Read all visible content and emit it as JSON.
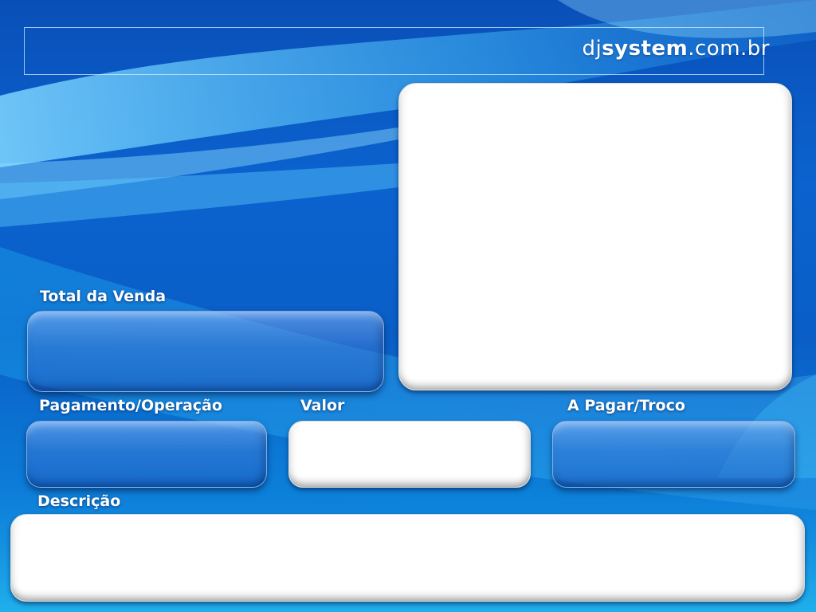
{
  "app": {
    "brand_prefix": "dj",
    "brand_strong": "system",
    "brand_suffix": ".com.br"
  },
  "display": {
    "image_panel": ""
  },
  "fields": {
    "total_venda": {
      "label": "Total da Venda",
      "value": ""
    },
    "pagamento_operacao": {
      "label": "Pagamento/Operação",
      "value": ""
    },
    "valor": {
      "label": "Valor",
      "value": ""
    },
    "a_pagar_troco": {
      "label": "A Pagar/Troco",
      "value": ""
    },
    "descricao": {
      "label": "Descrição",
      "value": ""
    }
  },
  "colors": {
    "background": "#0a5ec6",
    "accent_light": "#16a4e6",
    "label_text": "#ffffff",
    "panel_white": "#ffffff"
  }
}
